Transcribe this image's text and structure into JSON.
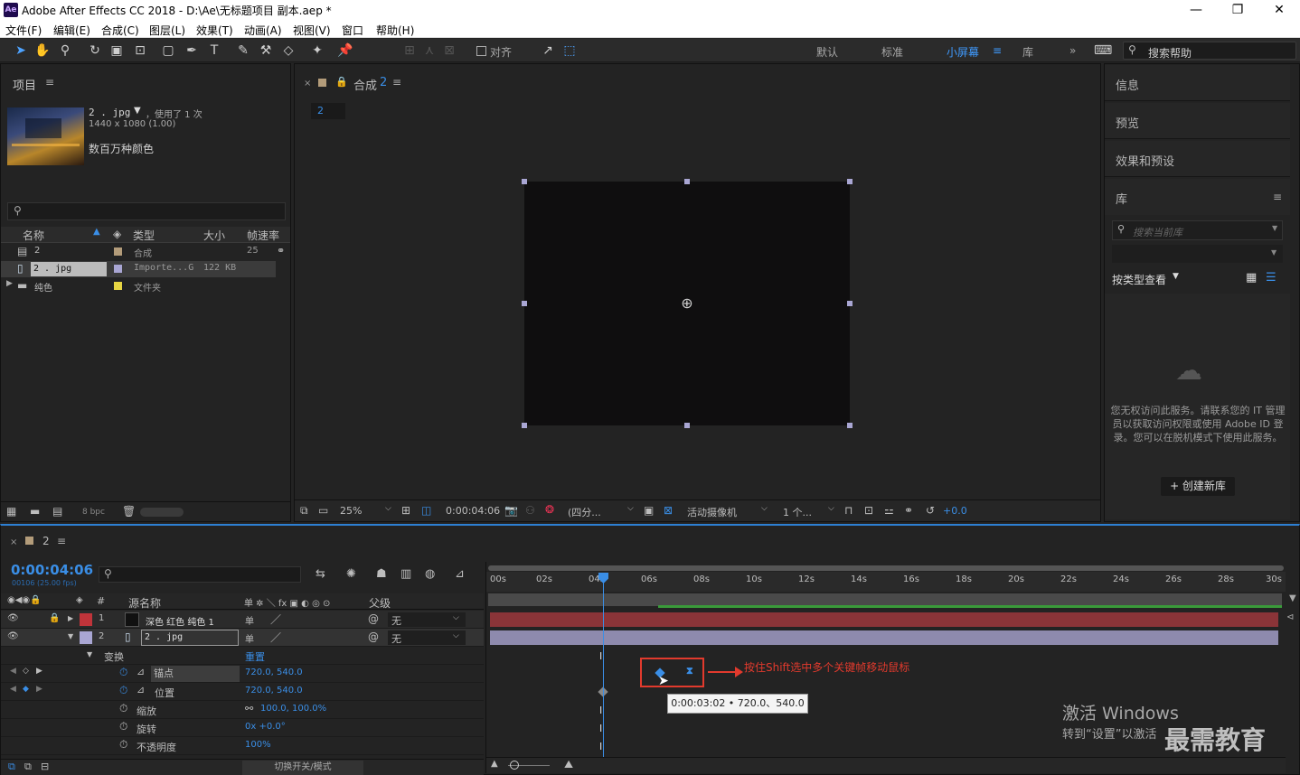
{
  "window": {
    "logo": "Ae",
    "title": "Adobe After Effects CC 2018 - D:\\Ae\\无标题项目 副本.aep *",
    "min": "—",
    "max": "❐",
    "close": "✕"
  },
  "menu": [
    "文件(F)",
    "编辑(E)",
    "合成(C)",
    "图层(L)",
    "效果(T)",
    "动画(A)",
    "视图(V)",
    "窗口",
    "帮助(H)"
  ],
  "toolbar": {
    "snap_label": "对齐",
    "workspaces": [
      "默认",
      "标准",
      "小屏幕",
      "库"
    ],
    "active_workspace": "小屏幕",
    "more": "»",
    "search_help": "搜索帮助"
  },
  "project": {
    "title": "项目",
    "thumb_name": "2 . jpg",
    "thumb_used": "，使用了 1 次",
    "thumb_dims": "1440 x 1080 (1.00)",
    "thumb_colors": "数百万种颜色",
    "search_placeholder": "",
    "columns": [
      "名称",
      "类型",
      "大小",
      "帧速率"
    ],
    "items": [
      {
        "name": "2",
        "type": "合成",
        "size": "",
        "fps": "25",
        "color": "#b39c7a"
      },
      {
        "name": "2 . jpg",
        "type": "Importe...G",
        "size": "122 KB",
        "fps": "",
        "color": "#a9a6d3"
      },
      {
        "name": "纯色",
        "type": "文件夹",
        "size": "",
        "fps": "",
        "color": "#e7d543"
      }
    ],
    "bpc": "8 bpc"
  },
  "viewer": {
    "tab": "合成",
    "tab_name": "2",
    "comp_chip": "2",
    "zoom": "25%",
    "timecode": "0:00:04:06",
    "resolution": "(四分...",
    "camera": "活动摄像机",
    "views": "1 个...",
    "exposure": "+0.0"
  },
  "right": {
    "info": "信息",
    "preview": "预览",
    "effects": "效果和预设",
    "library": "库",
    "lib_search": "搜索当前库",
    "view_by": "按类型查看",
    "message": "您无权访问此服务。请联系您的 IT 管理员以获取访问权限或使用 Adobe ID 登录。您可以在脱机模式下使用此服务。",
    "create_btn": "+ 创建新库"
  },
  "timeline": {
    "tab_name": "2",
    "timecode": "0:00:04:06",
    "fps": "00106 (25.00 fps)",
    "col_num": "#",
    "col_name": "源名称",
    "col_switches": "单 ✲ ＼ fx ▣ ◐ ◎ ⊙",
    "col_parent": "父级",
    "layers": [
      {
        "num": "1",
        "name": "深色 红色 纯色 1",
        "color": "#c0343a",
        "parent": "无"
      },
      {
        "num": "2",
        "name": "2 . jpg",
        "color": "#a9a6d3",
        "parent": "无"
      }
    ],
    "transform": "变换",
    "reset": "重置",
    "props": [
      {
        "name": "锚点",
        "value": "720.0, 540.0"
      },
      {
        "name": "位置",
        "value": "720.0, 540.0"
      },
      {
        "name": "缩放",
        "value": "100.0, 100.0%"
      },
      {
        "name": "旋转",
        "value": "0x +0.0°"
      },
      {
        "name": "不透明度",
        "value": "100%"
      }
    ],
    "ticks": [
      "00s",
      "02s",
      "04s",
      "06s",
      "08s",
      "10s",
      "12s",
      "14s",
      "16s",
      "18s",
      "20s",
      "22s",
      "24s",
      "26s",
      "28s",
      "30s"
    ],
    "annotation": "按住Shift选中多个关键帧移动鼠标",
    "tooltip": "0:00:03:02 • 720.0、540.0",
    "toggle": "切换开关/模式"
  },
  "watermark": {
    "line1": "激活 Windows",
    "line2": "转到“设置”以激活",
    "brand": "最需教育"
  },
  "colors": {
    "accent": "#2d8ceb",
    "annotation": "#e23a2d"
  }
}
